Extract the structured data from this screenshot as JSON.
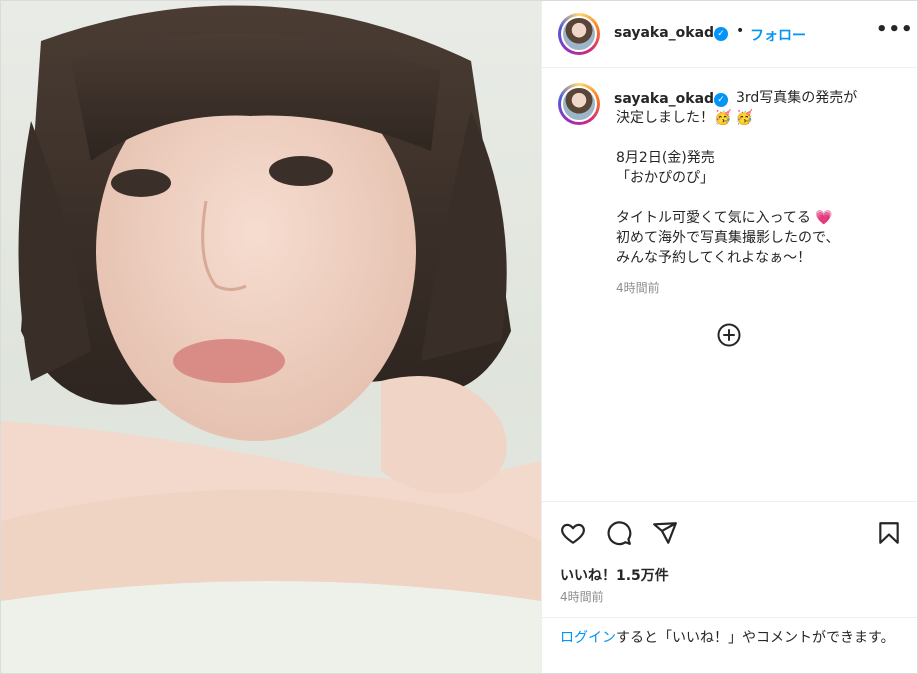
{
  "post": {
    "username": "sayaka_okada",
    "follow_label": "フォロー",
    "more_label": "•••",
    "dot": "•",
    "verified_mark": "✓",
    "caption": {
      "line1": "3rd写真集の発売が",
      "line2": "決定しました！🥳 🥳",
      "line3": "8月2日(金)発売",
      "line4": "「おかぴのぴ」",
      "line5": "タイトル可愛くて気に入ってる 💗",
      "line6": "初めて海外で写真集撮影したので、",
      "line7": "みんな予約してくれよなぁ～！"
    },
    "caption_time": "4時間前",
    "likes": "いいね！1.5万件",
    "post_time": "4時間前",
    "login": {
      "link": "ログイン",
      "rest": "すると「いいね！」やコメントができます。"
    }
  },
  "icons": [
    "heart-icon",
    "comment-icon",
    "share-icon",
    "bookmark-icon",
    "add-icon",
    "more-icon",
    "verified-icon"
  ],
  "colors": {
    "accent": "#0095f6",
    "text": "#262626",
    "muted": "#8e8e8e",
    "border": "#efefef"
  }
}
